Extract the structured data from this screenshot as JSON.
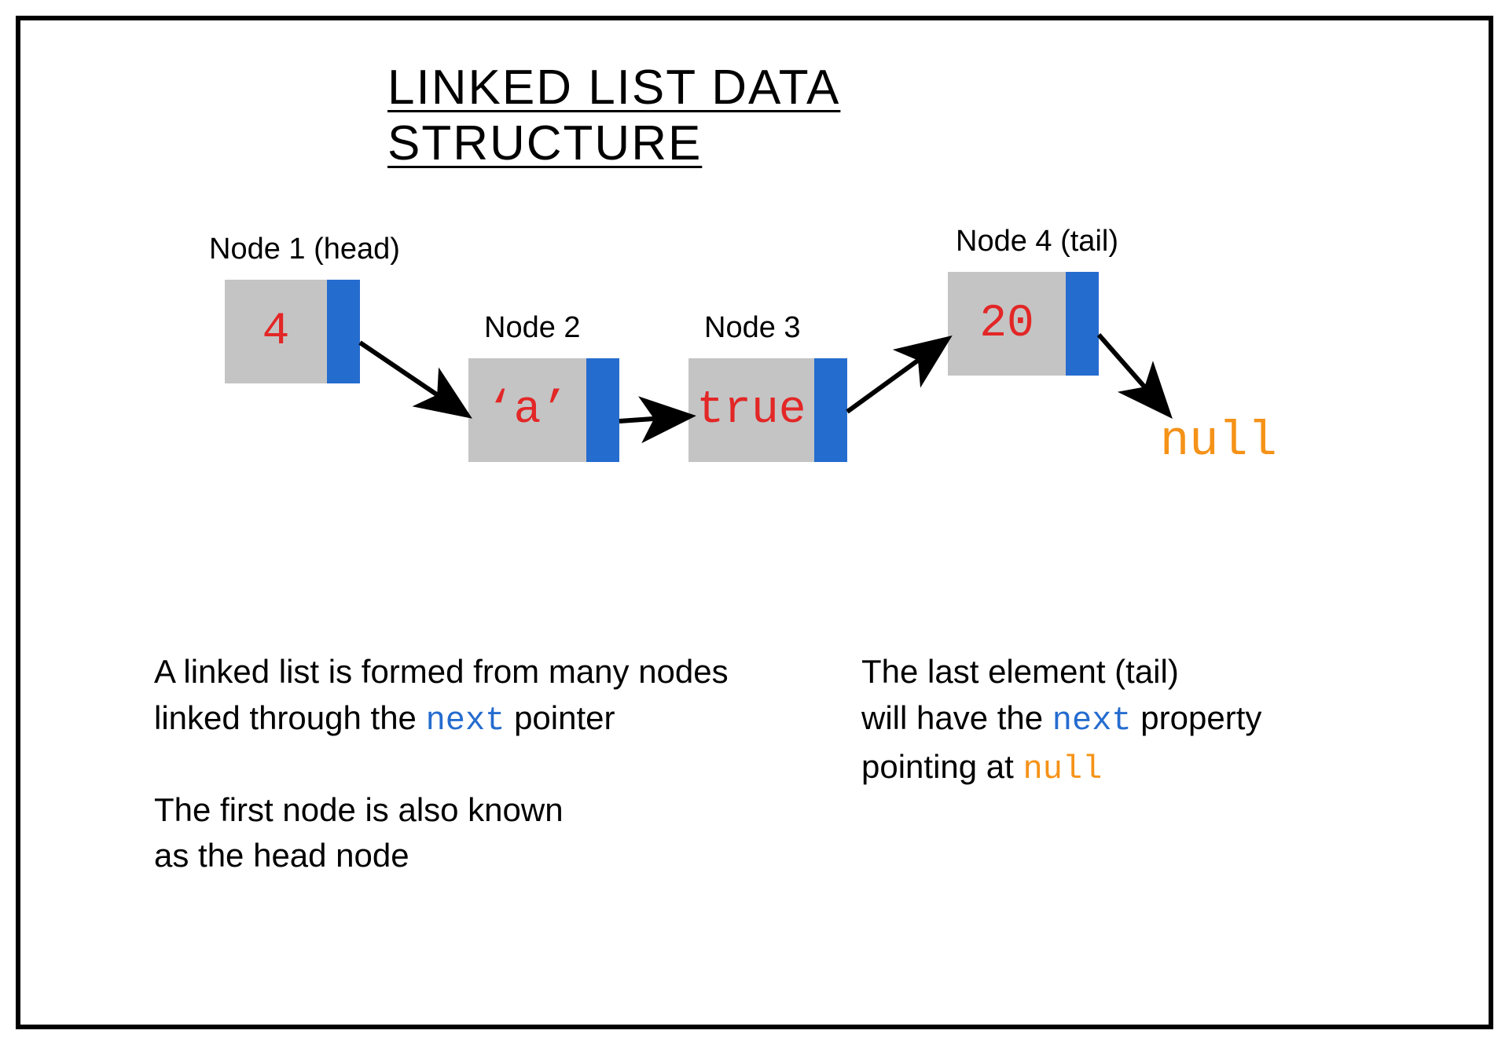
{
  "title": "LINKED LIST DATA STRUCTURE",
  "nodes": [
    {
      "label": "Node 1 (head)",
      "value": "4",
      "data_width": 130
    },
    {
      "label": "Node 2",
      "value": "‘a’",
      "data_width": 150
    },
    {
      "label": "Node 3",
      "value": "true",
      "data_width": 160
    },
    {
      "label": "Node 4 (tail)",
      "value": "20",
      "data_width": 150
    }
  ],
  "tail_points_to": "null",
  "descriptions": {
    "left_p1_a": "A linked list is formed from many nodes",
    "left_p1_b": "linked through the ",
    "left_p1_c": " pointer",
    "left_p2_a": "The first node is also known",
    "left_p2_b": "as the head node",
    "right_a": "The last element (tail)",
    "right_b": "will have the ",
    "right_c": " property",
    "right_d": "pointing at ",
    "kw_next": "next",
    "kw_null": "null"
  },
  "colors": {
    "value": "#e32626",
    "pointer": "#256ccf",
    "null": "#f59218",
    "node_bg": "#c4c4c4"
  }
}
